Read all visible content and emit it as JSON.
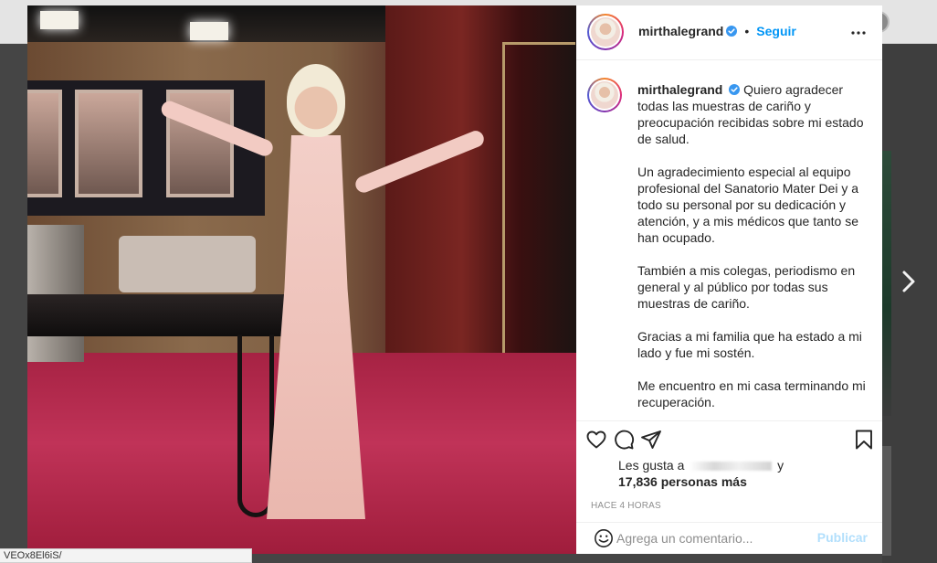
{
  "post": {
    "username": "mirthalegrand",
    "follow_label": "Seguir",
    "separator": "•",
    "caption": {
      "username": "mirthalegrand",
      "paragraphs": [
        "Quiero agradecer todas las muestras de cariño y preocupación recibidas sobre mi estado de salud.",
        "Un agradecimiento especial al equipo profesional del Sanatorio Mater Dei y a todo su personal por su dedicación y atención, y a mis médicos que tanto se han ocupado.",
        "También a mis colegas, periodismo en general y al público por todas sus muestras de cariño.",
        "Gracias a mi familia que ha estado a mi lado y fue mi sostén.",
        "Me encuentro en mi casa terminando mi recuperación."
      ]
    },
    "likes": {
      "prefix": "Les gusta a",
      "suffix": "y",
      "count_text": "17,836 personas más"
    },
    "timestamp": "Hace 4 horas",
    "comment": {
      "placeholder": "Agrega un comentario...",
      "publish_label": "Publicar"
    }
  },
  "status_bar": {
    "url": "VEOx8El6iS/"
  },
  "icons": {
    "verified": "verified-badge-icon",
    "more": "more-options-icon",
    "like": "heart-icon",
    "comment": "comment-bubble-icon",
    "share": "paper-plane-icon",
    "save": "bookmark-icon",
    "emoji": "emoji-smile-icon",
    "next": "chevron-right-icon"
  },
  "colors": {
    "accent": "#0095f6",
    "publish_disabled": "#b2dffc",
    "muted": "#8e8e8e",
    "text": "#262626"
  }
}
